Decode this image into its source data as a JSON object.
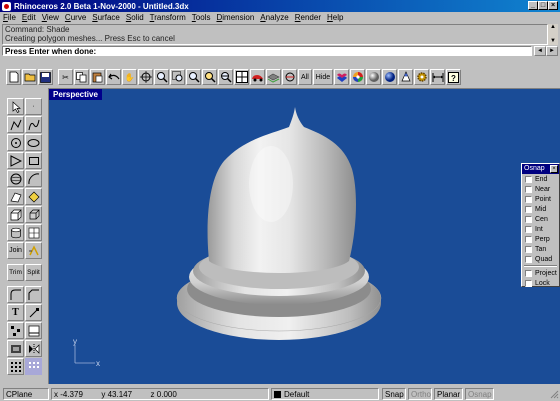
{
  "window": {
    "title": "Rhinoceros 2.0 Beta 1-Nov-2000 - Untitled.3dx"
  },
  "menu": [
    "File",
    "Edit",
    "View",
    "Curve",
    "Surface",
    "Solid",
    "Transform",
    "Tools",
    "Dimension",
    "Analyze",
    "Render",
    "Help"
  ],
  "command": {
    "history": [
      "Command: Shade",
      "Creating polygon meshes... Press Esc to cancel"
    ],
    "prompt": "Press Enter when done:"
  },
  "toolbar": {
    "icons": [
      "new-file-icon",
      "open-icon",
      "save-icon",
      "cut-icon",
      "copy-icon",
      "paste-icon",
      "undo-icon",
      "pan-hand-icon",
      "rotate-view-icon",
      "zoom-dynamic-icon",
      "zoom-window-icon",
      "zoom-extents-icon",
      "zoom-selected-icon",
      "undo-view-icon",
      "four-viewports-icon",
      "car-icon",
      "layer-icon",
      "select-all-icon"
    ],
    "all_label": "All",
    "hide_label": "Hide",
    "render_icons": [
      "hearts-icon",
      "color-wheel-icon",
      "shade-sphere-icon",
      "render-sphere-icon",
      "light-icon",
      "gear-cog-icon",
      "dimension-icon",
      "help-icon"
    ]
  },
  "lefttools": {
    "join_label": "Join",
    "trim_label": "Trim",
    "split_label": "Split",
    "text_label": "T"
  },
  "viewport": {
    "title": "Perspective",
    "axis_y": "y",
    "axis_x": "x"
  },
  "osnap": {
    "title": "Osnap",
    "items": [
      "End",
      "Near",
      "Point",
      "Mid",
      "Cen",
      "Int",
      "Perp",
      "Tan",
      "Quad"
    ],
    "extra": [
      "Project",
      "Lock"
    ]
  },
  "status": {
    "cplane": "CPlane",
    "x": "x -4.379",
    "y": "y 43.147",
    "z": "z 0.000",
    "layer": "Default",
    "snap": "Snap",
    "ortho": "Ortho",
    "planar": "Planar",
    "osnap": "Osnap"
  }
}
